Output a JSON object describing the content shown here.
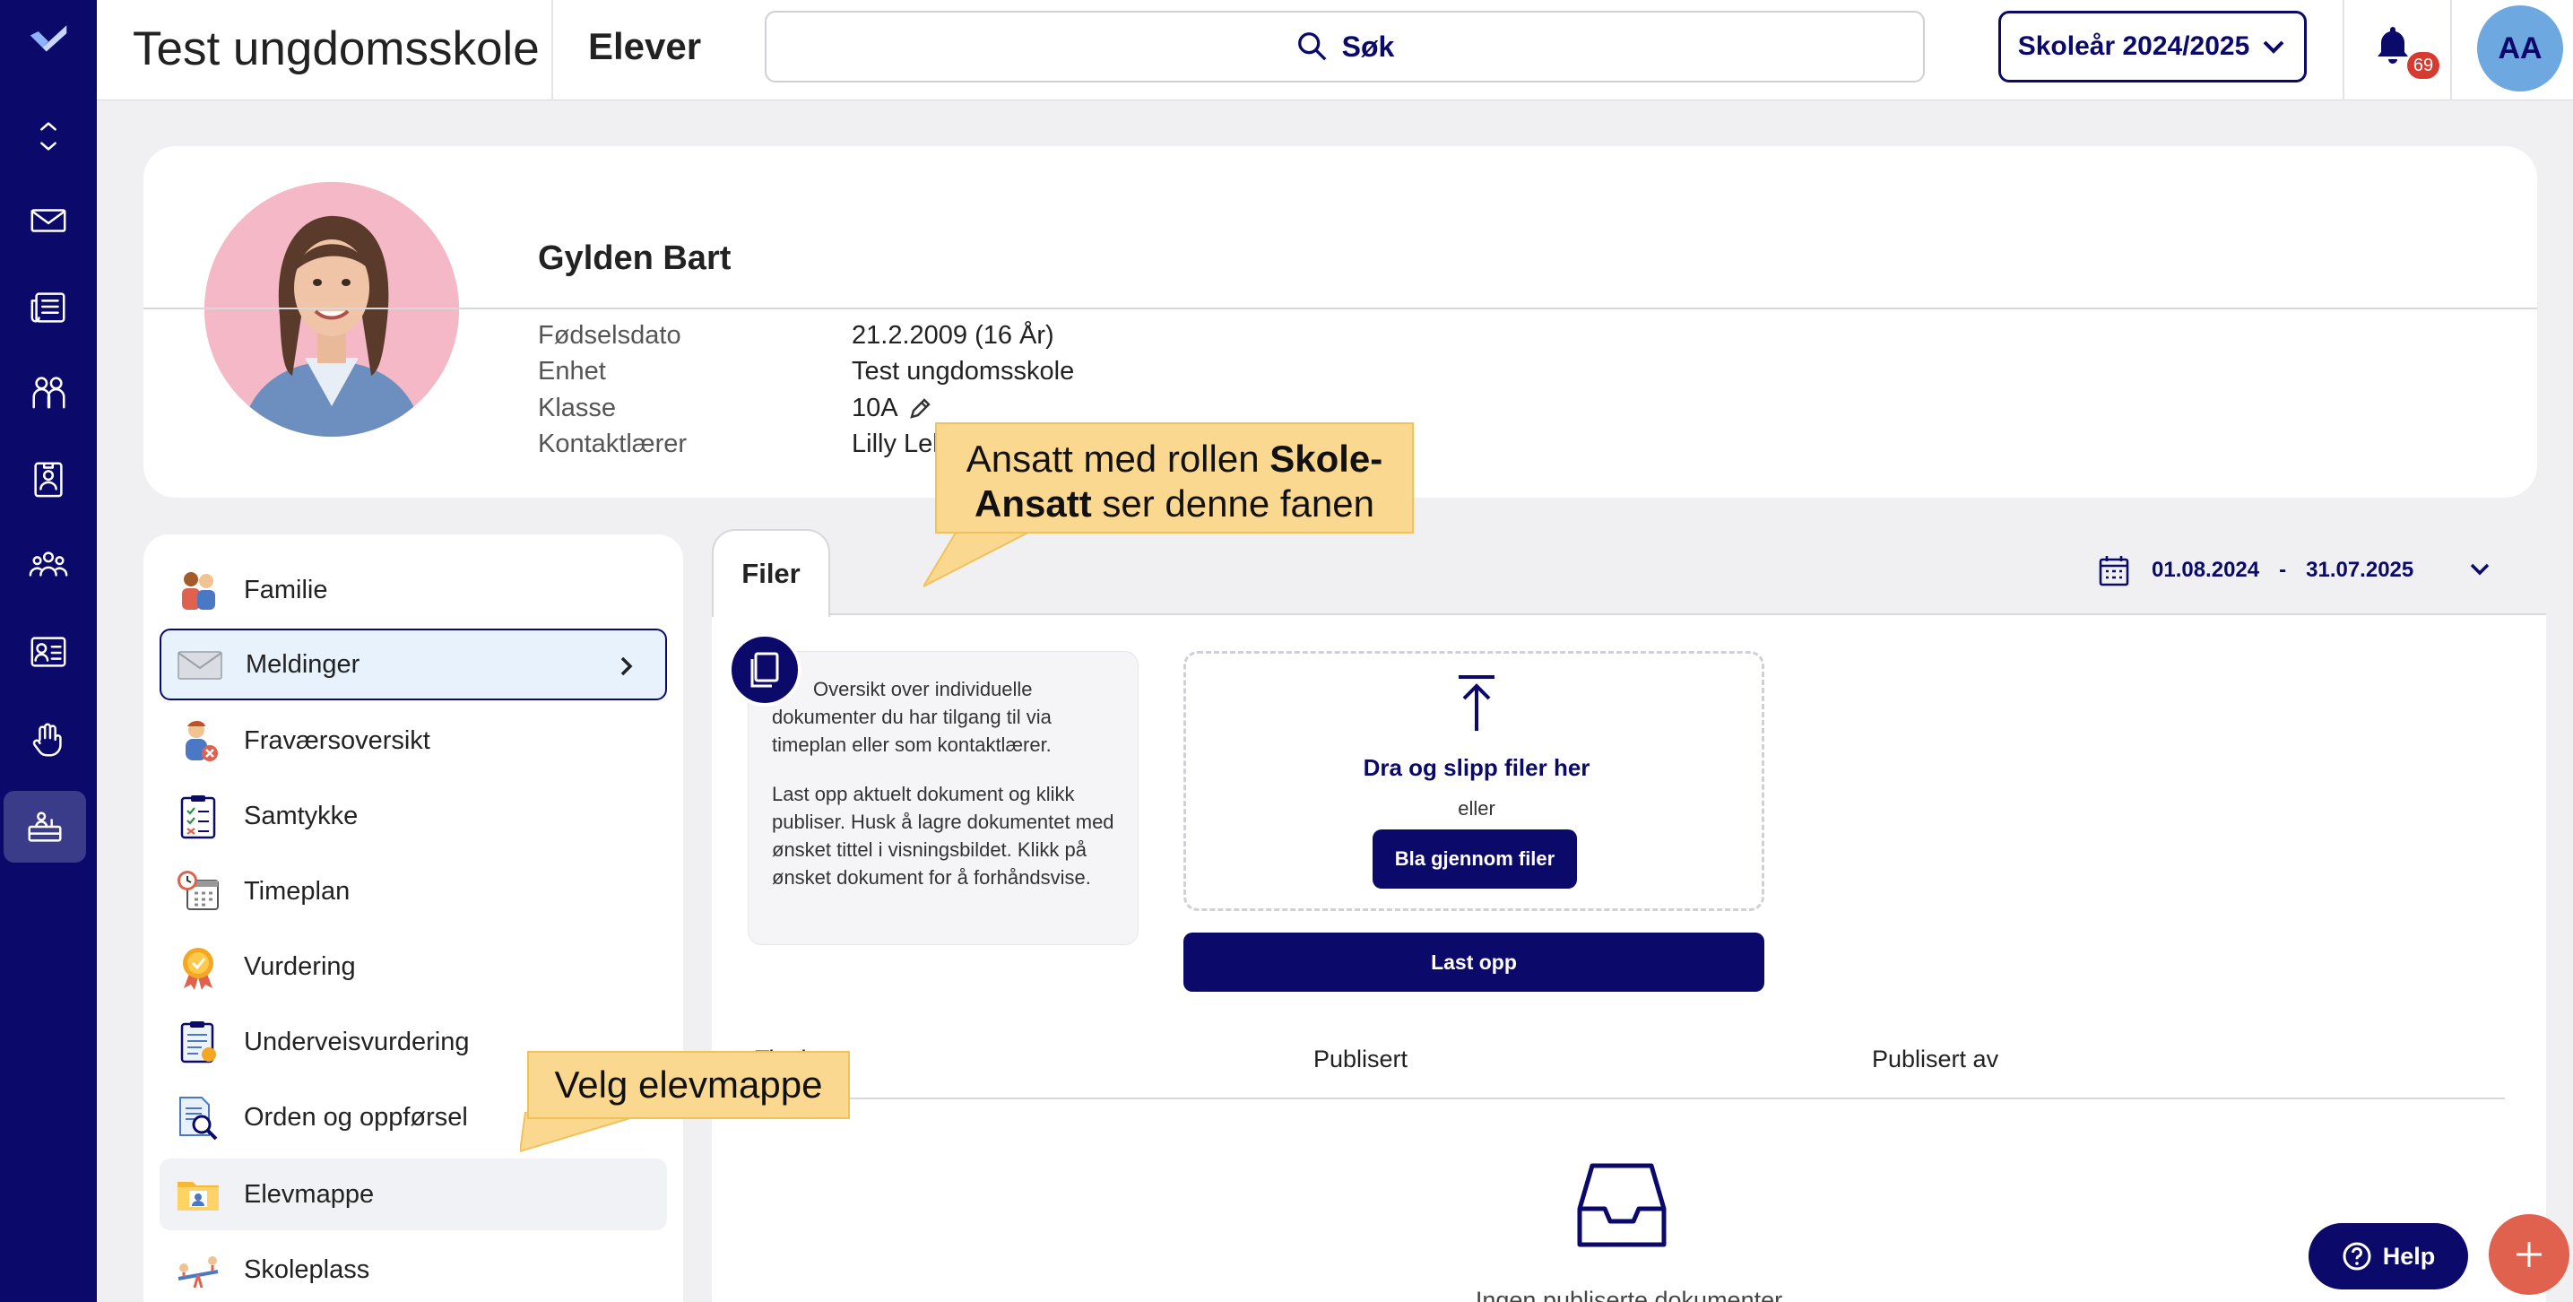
{
  "app": {
    "school_name": "Test ungdomsskole",
    "module_title": "Elever",
    "search_placeholder": "Søk",
    "school_year": "Skoleår 2024/2025",
    "notification_count": "69",
    "user_initials": "AA"
  },
  "rail": {
    "icons": [
      "logo-icon",
      "expand-collapse-icon",
      "mail-icon",
      "news-icon",
      "people-icon",
      "contact-card-icon",
      "group-icon",
      "id-card-icon",
      "hand-icon",
      "desk-icon"
    ],
    "active": "desk-icon"
  },
  "student": {
    "name": "Gylden Bart",
    "fields": [
      {
        "label": "Fødselsdato",
        "value": "21.2.2009 (16 År)"
      },
      {
        "label": "Enhet",
        "value": "Test ungdomsskole"
      },
      {
        "label": "Klasse",
        "value": "10A"
      },
      {
        "label": "Kontaktlærer",
        "value": "Lilly Lek"
      }
    ]
  },
  "menu": {
    "items": [
      {
        "label": "Familie",
        "icon": "family-icon"
      },
      {
        "label": "Meldinger",
        "icon": "envelope-icon",
        "selected": true
      },
      {
        "label": "Fraværsoversikt",
        "icon": "absence-icon"
      },
      {
        "label": "Samtykke",
        "icon": "consent-clipboard-icon"
      },
      {
        "label": "Timeplan",
        "icon": "schedule-icon"
      },
      {
        "label": "Vurdering",
        "icon": "rating-medal-icon"
      },
      {
        "label": "Underveisvurdering",
        "icon": "assessment-clipboard-icon"
      },
      {
        "label": "Orden og oppførsel",
        "icon": "conduct-search-icon"
      },
      {
        "label": "Elevmappe",
        "icon": "student-folder-icon",
        "highlighted": true
      },
      {
        "label": "Skoleplass",
        "icon": "playground-icon"
      }
    ]
  },
  "files": {
    "tab_label": "Filer",
    "date_from": "01.08.2024",
    "date_separator": "-",
    "date_to": "31.07.2025",
    "info_paragraph_1": "Oversikt over individuelle dokumenter du har tilgang til via timeplan eller som kontaktlærer.",
    "info_paragraph_2": "Last opp aktuelt dokument og klikk publiser. Husk å lagre dokumentet med ønsket tittel i visningsbildet. Klikk på ønsket dokument for å forhåndsvise.",
    "drop_title": "Dra og slipp filer her",
    "drop_or": "eller",
    "browse_label": "Bla gjennom filer",
    "upload_label": "Last opp",
    "columns": [
      "Tittel",
      "Publisert",
      "Publisert av"
    ],
    "empty_text": "Ingen publiserte dokumenter"
  },
  "callouts": {
    "tab_note_pre": "Ansatt med rollen ",
    "tab_note_bold": "Skole-Ansatt",
    "tab_note_post": " ser denne fanen",
    "menu_note": "Velg elevmappe"
  },
  "help_label": "Help",
  "colors": {
    "brand_navy": "#0b0a6b",
    "callout_yellow": "#fbd88f",
    "selected_bg": "#e7f2fc",
    "fab_red": "#e0614e",
    "badge_red": "#d63b2f"
  }
}
